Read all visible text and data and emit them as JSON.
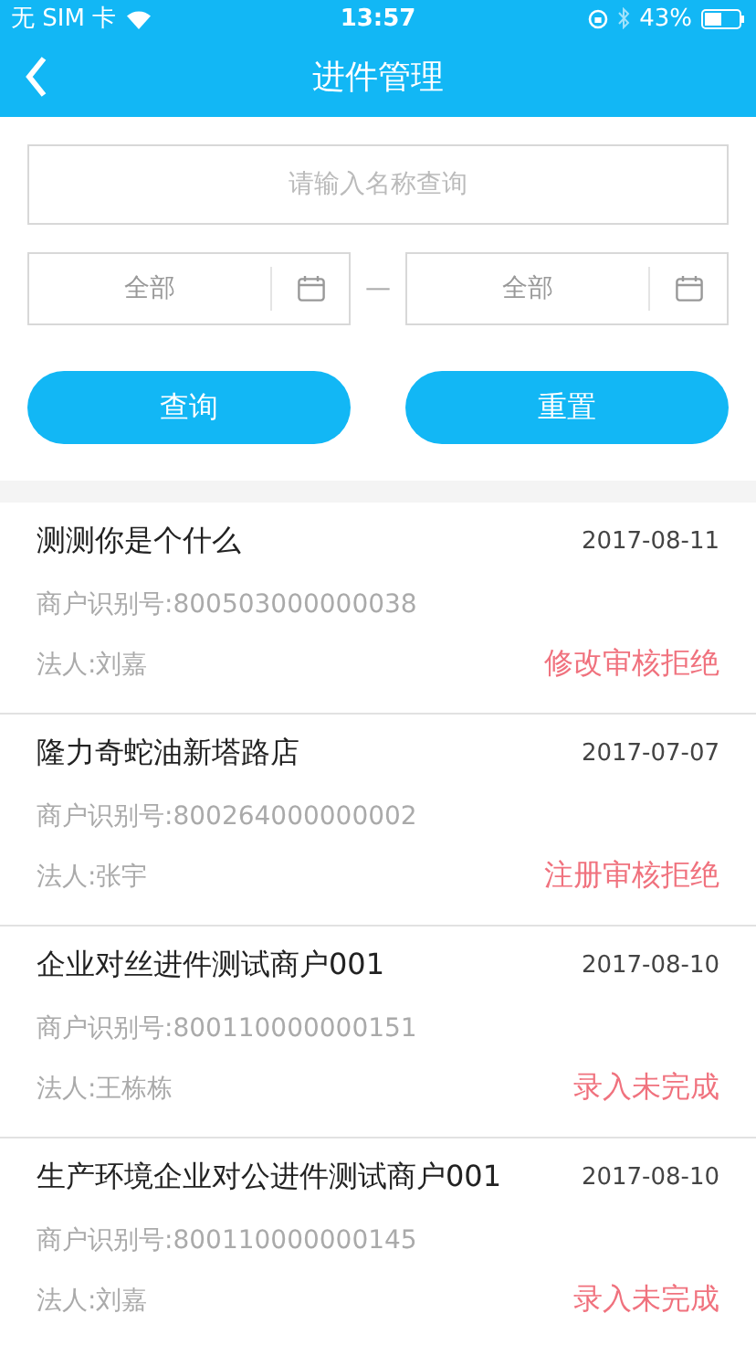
{
  "status_bar": {
    "carrier": "无 SIM 卡",
    "time": "13:57",
    "battery": "43%"
  },
  "nav": {
    "title": "进件管理"
  },
  "search": {
    "placeholder": "请输入名称查询"
  },
  "date_range": {
    "start": {
      "value": "全部"
    },
    "separator": "—",
    "end": {
      "value": "全部"
    }
  },
  "buttons": [
    "查询",
    "重置"
  ],
  "merchants": [
    {
      "name": "测测你是个什么",
      "date": "2017-08-11",
      "merchant_id": "商户识别号:800503000000038",
      "legal_person": "法人:刘嘉",
      "status": "修改审核拒绝"
    },
    {
      "name": "隆力奇蛇油新塔路店",
      "date": "2017-07-07",
      "merchant_id": "商户识别号:800264000000002",
      "legal_person": "法人:张宇",
      "status": "注册审核拒绝"
    },
    {
      "name": "企业对丝进件测试商户001",
      "date": "2017-08-10",
      "merchant_id": "商户识别号:800110000000151",
      "legal_person": "法人:王栋栋",
      "status": "录入未完成"
    },
    {
      "name": "生产环境企业对公进件测试商户001",
      "date": "2017-08-10",
      "merchant_id": "商户识别号:800110000000145",
      "legal_person": "法人:刘嘉",
      "status": "录入未完成"
    }
  ]
}
